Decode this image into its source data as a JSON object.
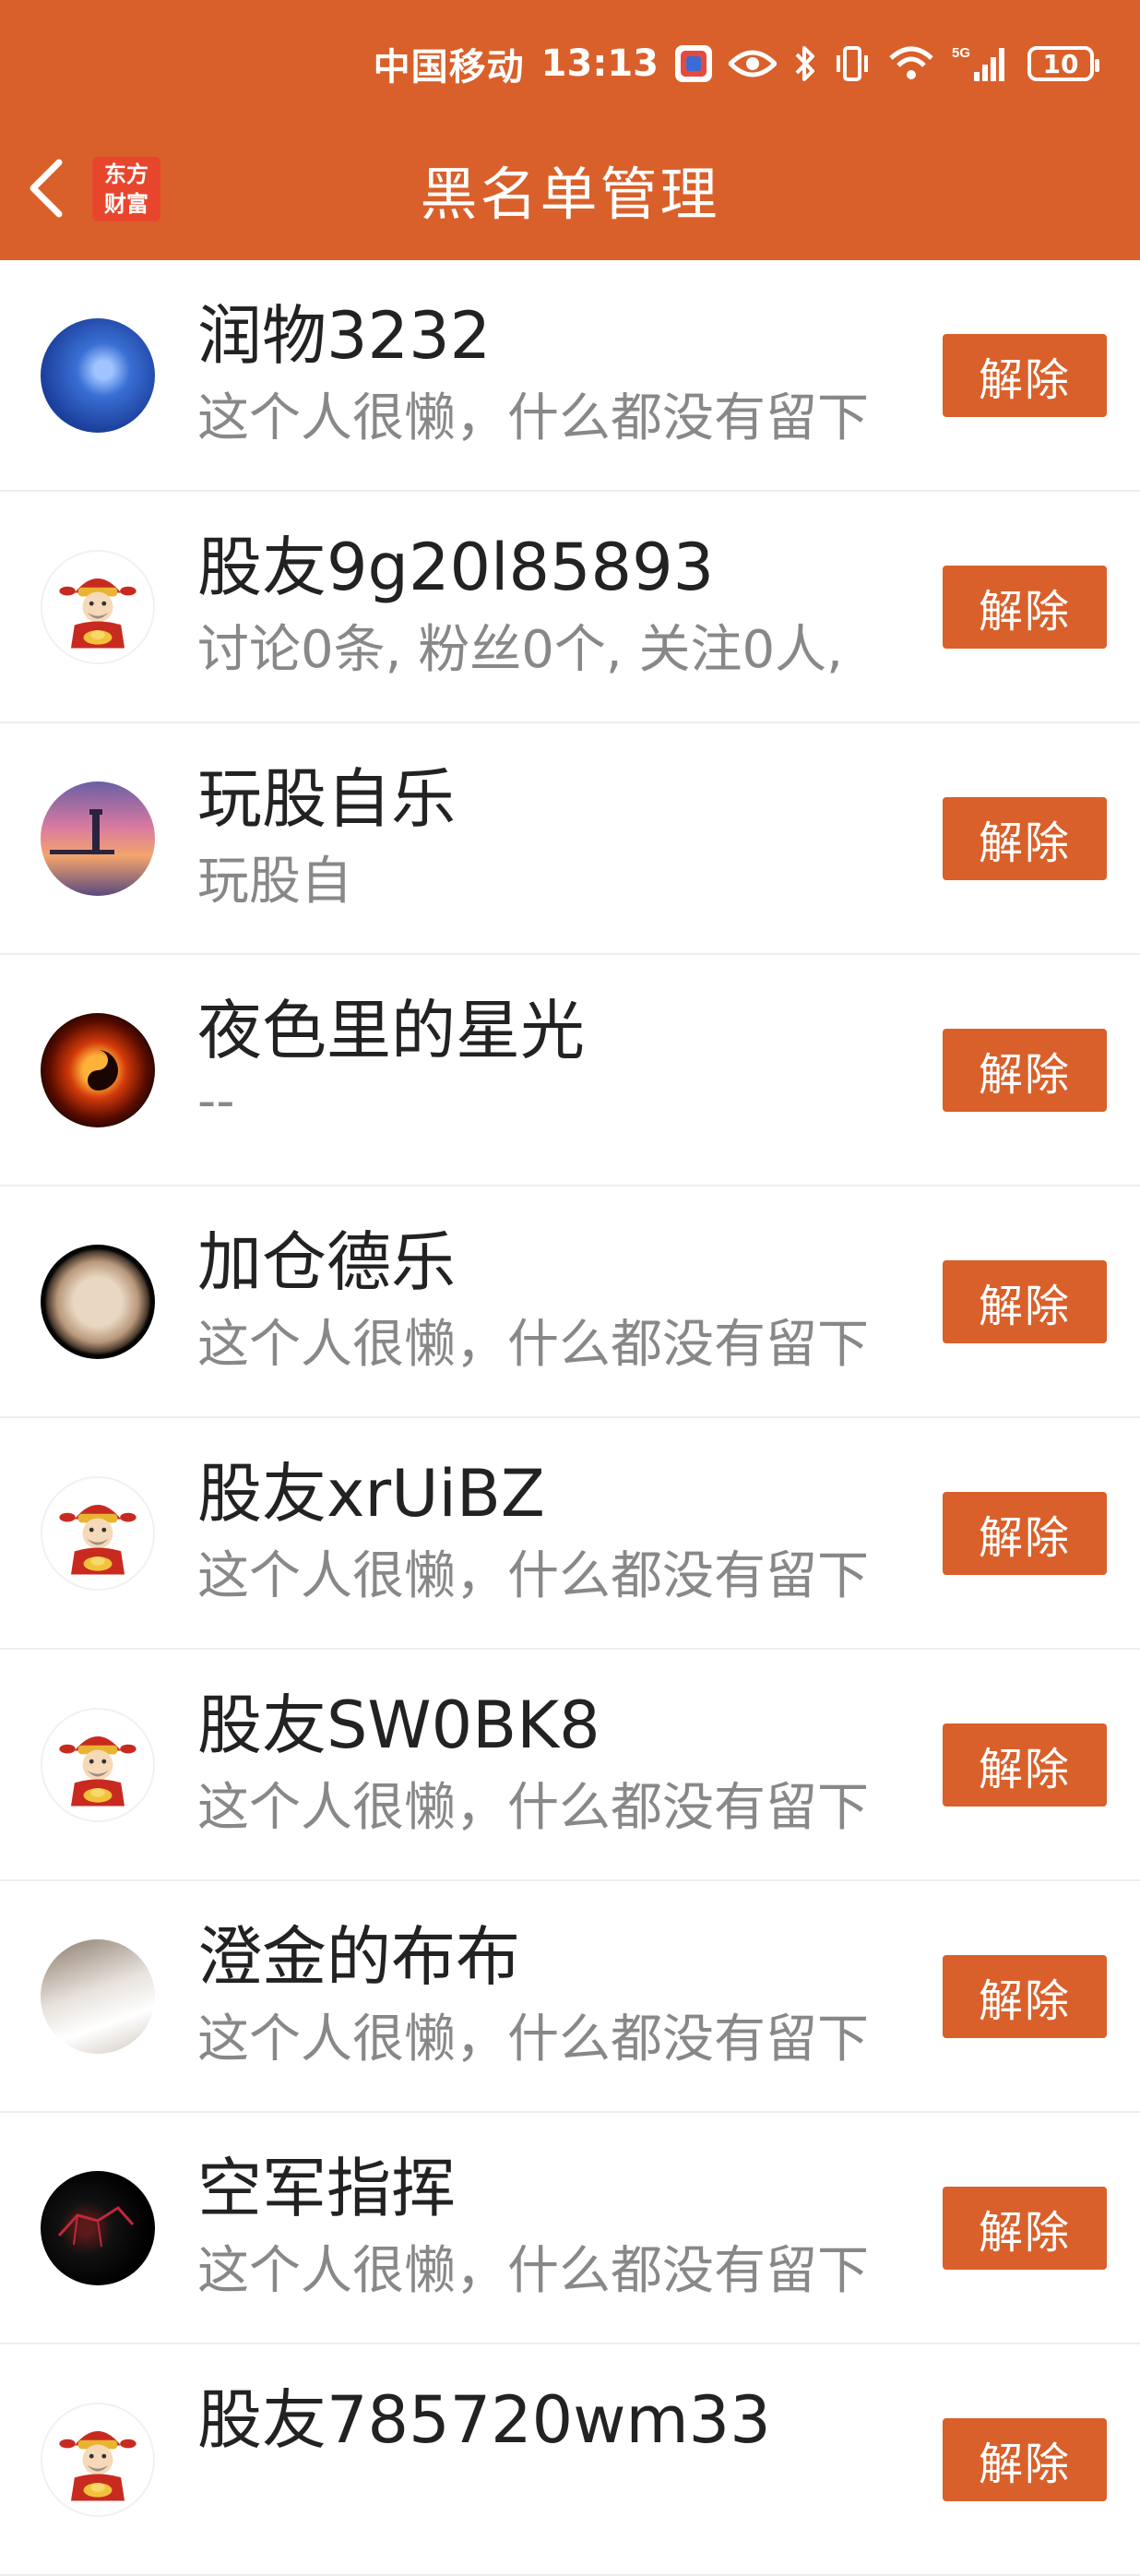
{
  "status_bar": {
    "carrier": "中国移动",
    "time": "13:13",
    "network": "5G",
    "battery": "10"
  },
  "nav": {
    "title": "黑名单管理",
    "logo_line1": "东方",
    "logo_line2": "财富"
  },
  "colors": {
    "accent": "#d9602a",
    "name_text": "#222222",
    "desc_text": "#888888"
  },
  "blacklist": [
    {
      "name": "润物3232",
      "desc": "这个人很懒，什么都没有留下",
      "avatar": "sky-avatar",
      "action": "解除"
    },
    {
      "name": "股友9g20l85893",
      "desc": "讨论0条, 粉丝0个, 关注0人,",
      "avatar": "caishen-avatar",
      "action": "解除"
    },
    {
      "name": "玩股自乐",
      "desc": "玩股自",
      "avatar": "lighthouse-sunset-avatar",
      "action": "解除"
    },
    {
      "name": "夜色里的星光",
      "desc": "--",
      "avatar": "fire-yinyang-avatar",
      "action": "解除"
    },
    {
      "name": "加仓德乐",
      "desc": "这个人很懒，什么都没有留下",
      "avatar": "planet-avatar",
      "action": "解除"
    },
    {
      "name": "股友xrUiBZ",
      "desc": "这个人很懒，什么都没有留下",
      "avatar": "caishen-avatar",
      "action": "解除"
    },
    {
      "name": "股友SW0BK8",
      "desc": "这个人很懒，什么都没有留下",
      "avatar": "caishen-avatar",
      "action": "解除"
    },
    {
      "name": "澄金的布布",
      "desc": "这个人很懒，什么都没有留下",
      "avatar": "cat-avatar",
      "action": "解除"
    },
    {
      "name": "空军指挥",
      "desc": "这个人很懒，什么都没有留下",
      "avatar": "dark-horse-avatar",
      "action": "解除"
    },
    {
      "name": "股友785720wm33",
      "desc": "",
      "avatar": "caishen-avatar",
      "action": "解除"
    }
  ]
}
